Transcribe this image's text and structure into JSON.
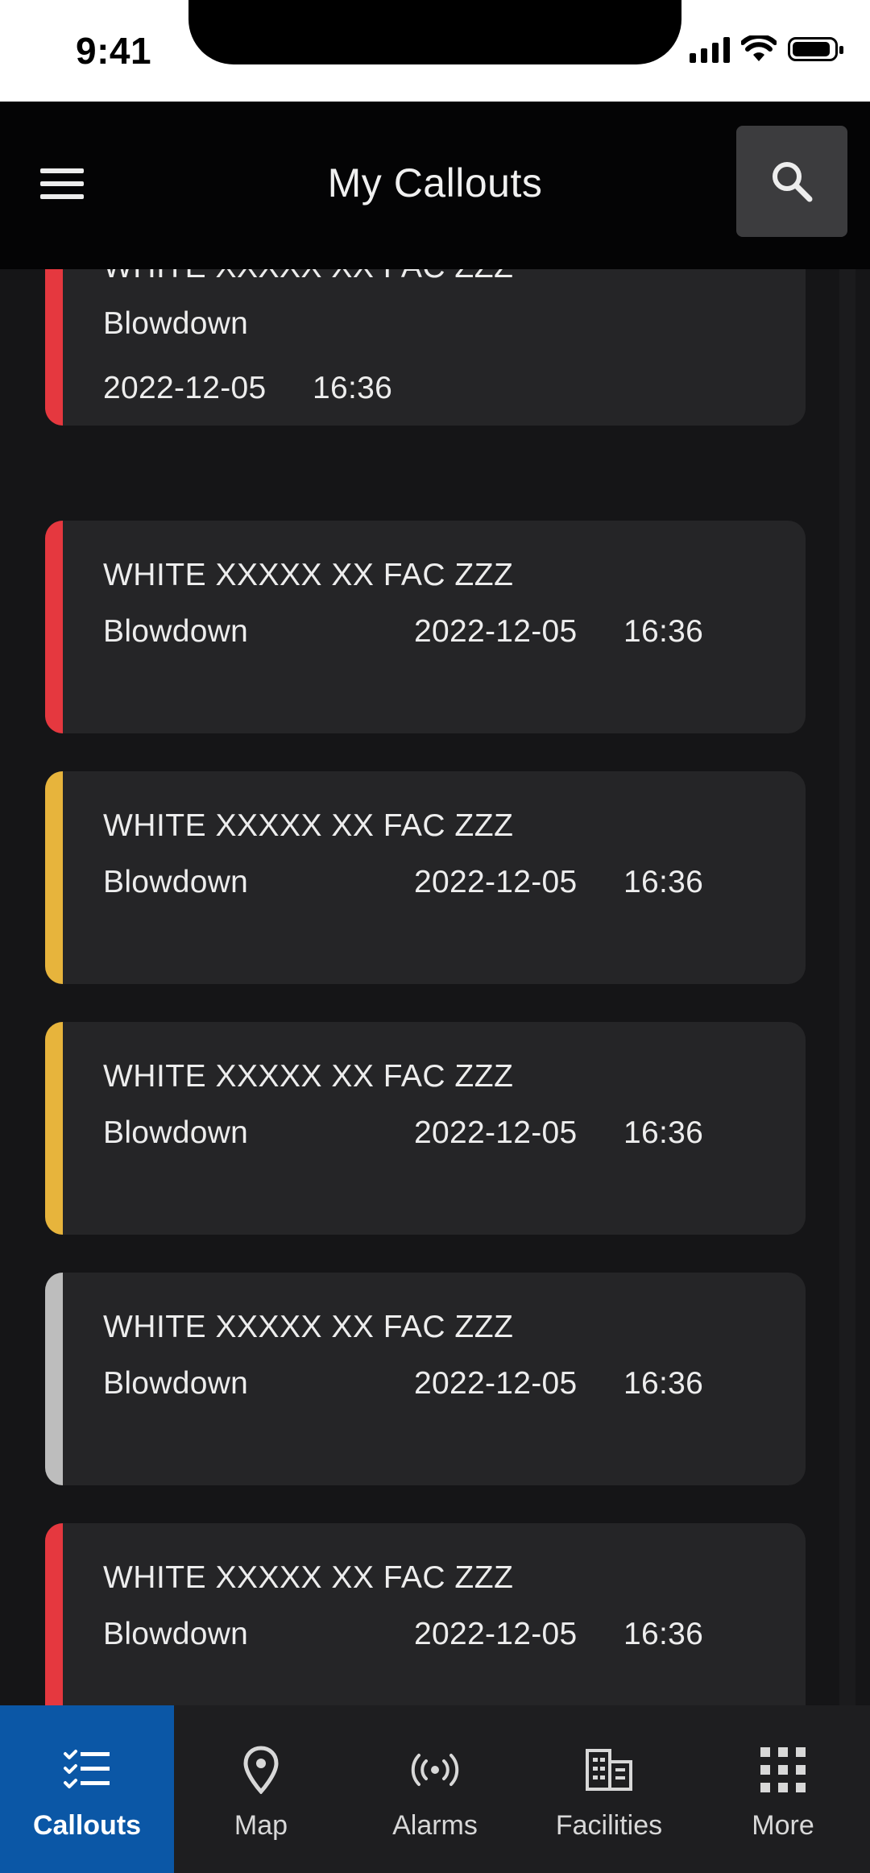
{
  "status_bar": {
    "time": "9:41"
  },
  "header": {
    "title": "My Callouts"
  },
  "callouts": [
    {
      "name": "WHITE XXXXX XX FAC ZZZ",
      "type": "Blowdown",
      "date": "2022-12-05",
      "time": "16:36",
      "status_color": "#E5383F"
    },
    {
      "name": "WHITE XXXXX XX FAC ZZZ",
      "type": "Blowdown",
      "date": "2022-12-05",
      "time": "16:36",
      "status_color": "#E5383F"
    },
    {
      "name": "WHITE XXXXX XX FAC ZZZ",
      "type": "Blowdown",
      "date": "2022-12-05",
      "time": "16:36",
      "status_color": "#E7B43C"
    },
    {
      "name": "WHITE XXXXX XX FAC ZZZ",
      "type": "Blowdown",
      "date": "2022-12-05",
      "time": "16:36",
      "status_color": "#E7B43C"
    },
    {
      "name": "WHITE XXXXX XX FAC ZZZ",
      "type": "Blowdown",
      "date": "2022-12-05",
      "time": "16:36",
      "status_color": "#BDBDBD"
    },
    {
      "name": "WHITE XXXXX XX FAC ZZZ",
      "type": "Blowdown",
      "date": "2022-12-05",
      "time": "16:36",
      "status_color": "#E5383F"
    }
  ],
  "bottom_nav": {
    "items": [
      {
        "label": "Callouts",
        "icon": "checklist-icon",
        "active": true
      },
      {
        "label": "Map",
        "icon": "map-pin-icon"
      },
      {
        "label": "Alarms",
        "icon": "broadcast-icon"
      },
      {
        "label": "Facilities",
        "icon": "building-icon"
      },
      {
        "label": "More",
        "icon": "grid-icon"
      }
    ]
  },
  "colors": {
    "accent": "#0B57A6",
    "background": "#151517",
    "card": "#252527",
    "header": "#040405",
    "red": "#E5383F",
    "yellow": "#E7B43C",
    "gray": "#BDBDBD"
  }
}
